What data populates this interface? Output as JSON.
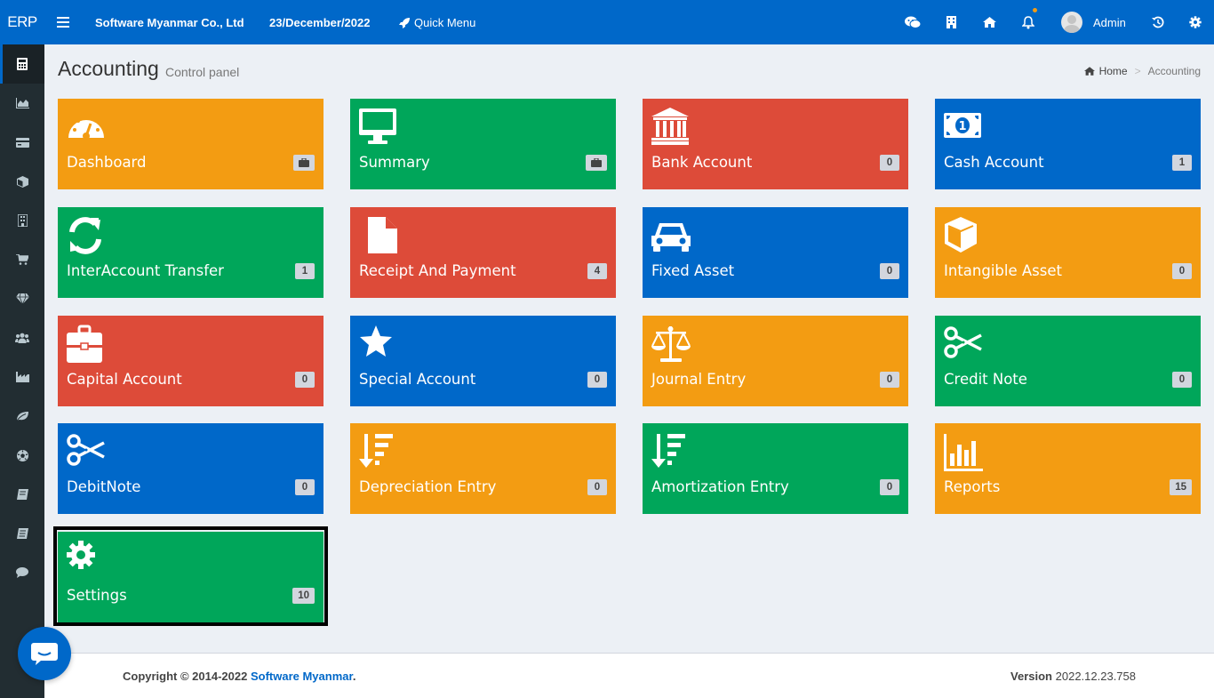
{
  "app": {
    "logo": "ERP",
    "company": "Software Myanmar Co., Ltd",
    "date": "23/December/2022",
    "quick_menu": "Quick Menu",
    "user": "Admin"
  },
  "header": {
    "title": "Accounting",
    "subtitle": "Control panel",
    "breadcrumb": {
      "home": "Home",
      "current": "Accounting"
    }
  },
  "sidebar": {
    "items": [
      {
        "icon": "calculator-icon"
      },
      {
        "icon": "area-chart-icon"
      },
      {
        "icon": "credit-card-icon"
      },
      {
        "icon": "cube-icon"
      },
      {
        "icon": "building-icon"
      },
      {
        "icon": "cart-icon"
      },
      {
        "icon": "diamond-icon"
      },
      {
        "icon": "users-icon"
      },
      {
        "icon": "industry-chart-icon"
      },
      {
        "icon": "leaf-icon"
      },
      {
        "icon": "soccer-ball-icon"
      },
      {
        "icon": "book-icon"
      },
      {
        "icon": "book-alt-icon"
      },
      {
        "icon": "comment-icon"
      }
    ]
  },
  "tiles": [
    {
      "label": "Dashboard",
      "badge": "",
      "color": "#f39c12",
      "icon": "dashboard-icon"
    },
    {
      "label": "Summary",
      "badge": "",
      "color": "#00a65a",
      "icon": "monitor-icon"
    },
    {
      "label": "Bank Account",
      "badge": "0",
      "color": "#dd4b39",
      "icon": "bank-icon"
    },
    {
      "label": "Cash Account",
      "badge": "1",
      "color": "#0068c9",
      "icon": "money-icon"
    },
    {
      "label": "InterAccount Transfer",
      "badge": "1",
      "color": "#00a65a",
      "icon": "refresh-icon"
    },
    {
      "label": "Receipt And Payment",
      "badge": "4",
      "color": "#dd4b39",
      "icon": "file-icon"
    },
    {
      "label": "Fixed Asset",
      "badge": "0",
      "color": "#0068c9",
      "icon": "car-icon"
    },
    {
      "label": "Intangible Asset",
      "badge": "0",
      "color": "#f39c12",
      "icon": "cube-icon"
    },
    {
      "label": "Capital Account",
      "badge": "0",
      "color": "#dd4b39",
      "icon": "briefcase-icon"
    },
    {
      "label": "Special Account",
      "badge": "0",
      "color": "#0068c9",
      "icon": "star-icon"
    },
    {
      "label": "Journal Entry",
      "badge": "0",
      "color": "#f39c12",
      "icon": "scale-icon"
    },
    {
      "label": "Credit Note",
      "badge": "0",
      "color": "#00a65a",
      "icon": "scissors-icon"
    },
    {
      "label": "DebitNote",
      "badge": "0",
      "color": "#0068c9",
      "icon": "scissors-icon"
    },
    {
      "label": "Depreciation Entry",
      "badge": "0",
      "color": "#f39c12",
      "icon": "sort-amount-down-icon"
    },
    {
      "label": "Amortization Entry",
      "badge": "0",
      "color": "#00a65a",
      "icon": "sort-amount-down-icon"
    },
    {
      "label": "Reports",
      "badge": "15",
      "color": "#f39c12",
      "icon": "bar-chart-icon"
    },
    {
      "label": "Settings",
      "badge": "10",
      "color": "#00a65a",
      "icon": "gear-icon"
    }
  ],
  "footer": {
    "copyright_prefix": "Copyright © 2014-2022 ",
    "brand": "Software Myanmar",
    "copyright_suffix": ".",
    "version_label": "Version",
    "version": "2022.12.23.758"
  }
}
